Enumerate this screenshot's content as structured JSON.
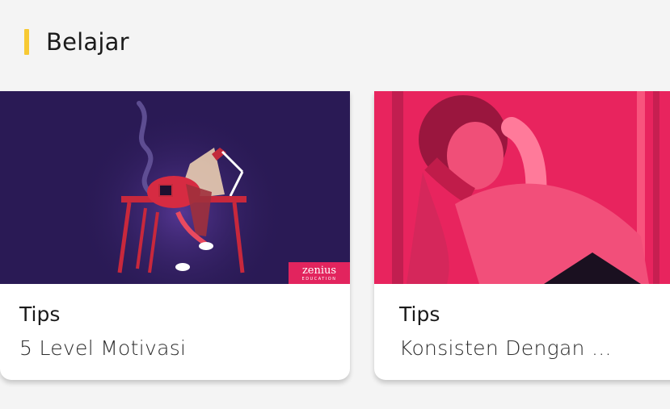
{
  "section": {
    "title": "Belajar"
  },
  "cards": [
    {
      "category": "Tips",
      "title": "5 Level Motivasi",
      "badge": {
        "name": "zenius",
        "sub": "EDUCATION"
      }
    },
    {
      "category": "Tips",
      "title": "Konsisten Dengan ..."
    }
  ],
  "colors": {
    "accent": "#f7c933",
    "card1_bg": "#2a1a55",
    "card2_bg": "#e8245e",
    "badge": "#e2245e"
  }
}
